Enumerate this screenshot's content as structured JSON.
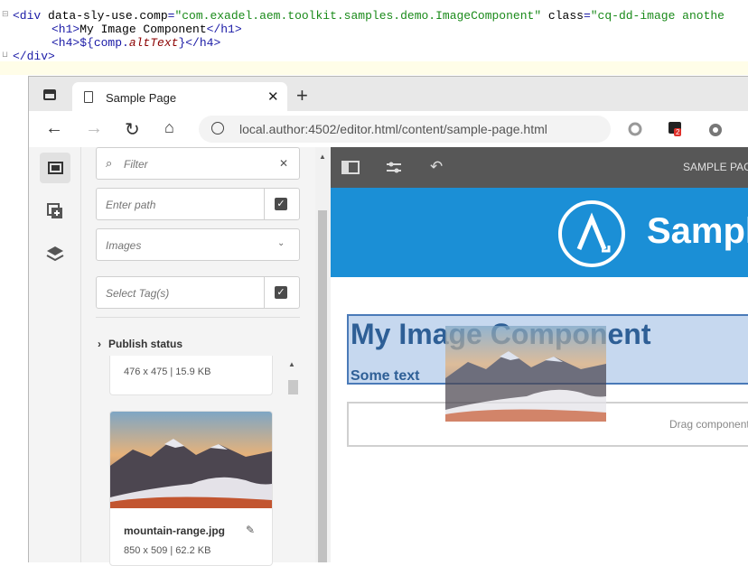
{
  "code": {
    "line1": {
      "open": "<div ",
      "attr1": "data-sly-use.comp",
      "eq1": "=",
      "val1": "\"com.exadel.aem.toolkit.samples.demo.ImageComponent\"",
      "attr2": " class",
      "eq2": "=",
      "val2": "\"cq-dd-image anothe"
    },
    "line2": {
      "text1": "<h1>",
      "text2": "My Image Component",
      "text3": "</h1>"
    },
    "line3": {
      "text1": "<h4>",
      "expr1": "${comp.",
      "expr2": "altText",
      "expr3": "}",
      "text2": "</h4>"
    },
    "line4": {
      "text1": "</div>"
    }
  },
  "browser": {
    "tab_title": "Sample Page",
    "new_tab": "+",
    "tab_close": "✕",
    "url": "local.author:4502/editor.html/content/sample-page.html",
    "badge_count": "2"
  },
  "assets_panel": {
    "filter_placeholder": "Filter",
    "path_placeholder": "Enter path",
    "type_select_value": "Images",
    "tags_placeholder": "Select Tag(s)",
    "publish_status_label": "Publish status",
    "assets": [
      {
        "name": "",
        "meta": "476 x 475 | 15.9 KB"
      },
      {
        "name": "mountain-range.jpg",
        "meta": "850 x 509 | 62.2 KB"
      }
    ]
  },
  "editor": {
    "toolbar_crumb": "SAMPLE PAGE",
    "hero_title": "Sample",
    "component": {
      "h1": "My Image Component",
      "h4": "Some text"
    },
    "drag_zone_text": "Drag components here"
  },
  "colors": {
    "hero_blue": "#1b8fd6",
    "selection_fill": "#c6d8ef",
    "selection_border": "#4a7ab8",
    "heading_text": "#2e5f96",
    "editor_toolbar": "#575757",
    "badge_red": "#e0312b"
  }
}
